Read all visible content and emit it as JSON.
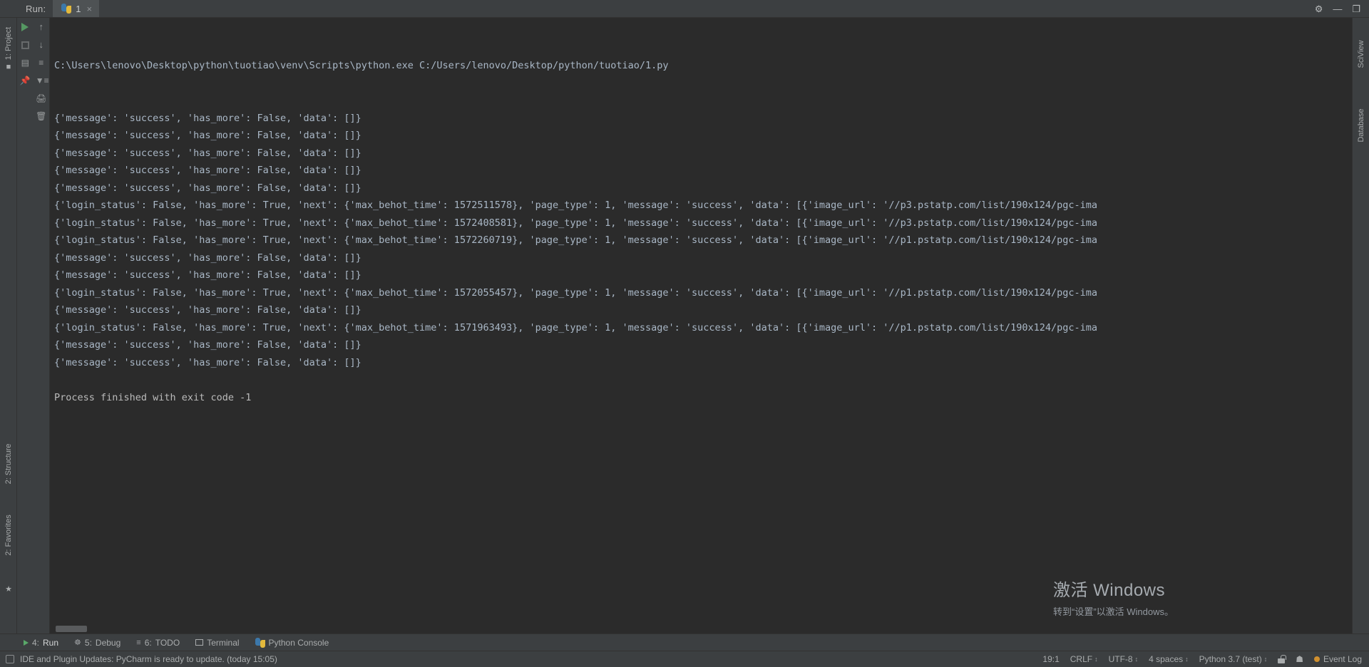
{
  "window": {
    "run_label": "Run:",
    "tab_name": "1",
    "tab_close": "×",
    "settings_icon": "⚙",
    "minimize": "—",
    "maximize": "❐"
  },
  "left_rail": {
    "project_label": "1: Project",
    "structure_label": "2: Structure",
    "favorites_label": "2: Favorites",
    "star_icon": "★",
    "folder_icon": "■"
  },
  "right_rail": {
    "database_label": "Database",
    "sciview_label": "SciView"
  },
  "run_gutter": {
    "rerun": "rerun-icon",
    "stop": "stop-icon",
    "up": "↑",
    "down": "↓",
    "layout": "▤",
    "filter": "≡",
    "sort": "↓≡",
    "pin": "⎘",
    "print": "⎙",
    "trash": "Ὕ1"
  },
  "console": {
    "command_line": "C:\\Users\\lenovo\\Desktop\\python\\tuotiao\\venv\\Scripts\\python.exe C:/Users/lenovo/Desktop/python/tuotiao/1.py",
    "lines": [
      "{'message': 'success', 'has_more': False, 'data': []}",
      "{'message': 'success', 'has_more': False, 'data': []}",
      "{'message': 'success', 'has_more': False, 'data': []}",
      "{'message': 'success', 'has_more': False, 'data': []}",
      "{'message': 'success', 'has_more': False, 'data': []}",
      "{'login_status': False, 'has_more': True, 'next': {'max_behot_time': 1572511578}, 'page_type': 1, 'message': 'success', 'data': [{'image_url': '//p3.pstatp.com/list/190x124/pgc-ima",
      "{'login_status': False, 'has_more': True, 'next': {'max_behot_time': 1572408581}, 'page_type': 1, 'message': 'success', 'data': [{'image_url': '//p3.pstatp.com/list/190x124/pgc-ima",
      "{'login_status': False, 'has_more': True, 'next': {'max_behot_time': 1572260719}, 'page_type': 1, 'message': 'success', 'data': [{'image_url': '//p1.pstatp.com/list/190x124/pgc-ima",
      "{'message': 'success', 'has_more': False, 'data': []}",
      "{'message': 'success', 'has_more': False, 'data': []}",
      "{'login_status': False, 'has_more': True, 'next': {'max_behot_time': 1572055457}, 'page_type': 1, 'message': 'success', 'data': [{'image_url': '//p1.pstatp.com/list/190x124/pgc-ima",
      "{'message': 'success', 'has_more': False, 'data': []}",
      "{'login_status': False, 'has_more': True, 'next': {'max_behot_time': 1571963493}, 'page_type': 1, 'message': 'success', 'data': [{'image_url': '//p1.pstatp.com/list/190x124/pgc-ima",
      "{'message': 'success', 'has_more': False, 'data': []}",
      "{'message': 'success', 'has_more': False, 'data': []}",
      "",
      "Process finished with exit code -1"
    ]
  },
  "watermark": {
    "title": "激活 Windows",
    "subtitle": "转到“设置”以激活 Windows。"
  },
  "bottom_tabs": [
    {
      "num": "4:",
      "label": "Run",
      "icon": "run-icon",
      "active": true
    },
    {
      "num": "5:",
      "label": "Debug",
      "icon": "debug-icon",
      "active": false
    },
    {
      "num": "6:",
      "label": "TODO",
      "icon": "todo-icon",
      "active": false
    },
    {
      "num": "",
      "label": "Terminal",
      "icon": "terminal-icon",
      "active": false
    },
    {
      "num": "",
      "label": "Python Console",
      "icon": "python-icon",
      "active": false
    }
  ],
  "status_bar": {
    "message": "IDE and Plugin Updates: PyCharm is ready to update. (today 15:05)",
    "caret": "19:1",
    "line_sep": "CRLF",
    "encoding": "UTF-8",
    "indent": "4 spaces",
    "interpreter": "Python 3.7 (test)",
    "event_log": "Event Log",
    "lock_icon": "lock-icon",
    "hat_icon": "☗"
  }
}
